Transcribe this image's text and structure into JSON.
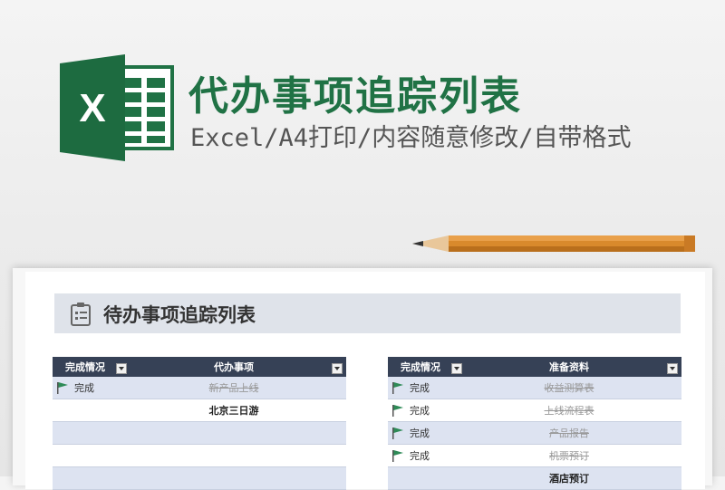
{
  "banner": {
    "title": "代办事项追踪列表",
    "subtitle": "Excel/A4打印/内容随意修改/自带格式",
    "logo_letter": "X",
    "brand_color": "#207245"
  },
  "sheet": {
    "title": "待办事项追踪列表",
    "header_bg": "#364156",
    "alt_row_bg": "#dde3f1"
  },
  "left_table": {
    "columns": [
      "完成情况",
      "代办事项"
    ],
    "rows": [
      {
        "status": "完成",
        "item": "新产品上线"
      },
      {
        "status": "",
        "item": "北京三日游"
      },
      {
        "status": "",
        "item": ""
      },
      {
        "status": "",
        "item": ""
      },
      {
        "status": "",
        "item": ""
      }
    ]
  },
  "right_table": {
    "columns": [
      "完成情况",
      "准备资料"
    ],
    "rows": [
      {
        "status": "完成",
        "item": "收益测算表"
      },
      {
        "status": "完成",
        "item": "上线流程表"
      },
      {
        "status": "完成",
        "item": "产品报告"
      },
      {
        "status": "完成",
        "item": "机票预订"
      },
      {
        "status": "",
        "item": "酒店预订"
      }
    ]
  }
}
